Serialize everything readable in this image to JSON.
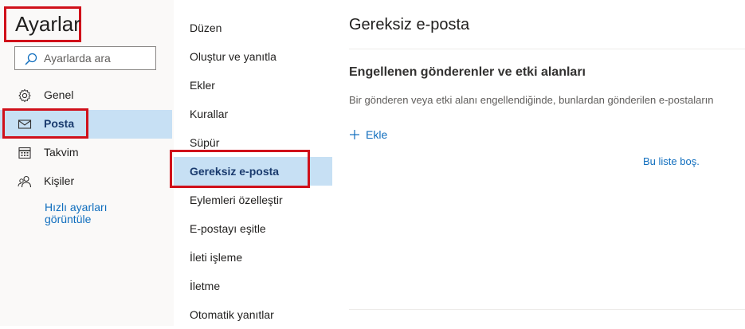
{
  "settings": {
    "title": "Ayarlar",
    "search_placeholder": "Ayarlarda ara",
    "nav": [
      {
        "label": "Genel",
        "icon": "gear-icon"
      },
      {
        "label": "Posta",
        "icon": "mail-icon",
        "selected": true
      },
      {
        "label": "Takvim",
        "icon": "calendar-icon"
      },
      {
        "label": "Kişiler",
        "icon": "people-icon"
      }
    ],
    "quick_settings_link": "Hızlı ayarları görüntüle"
  },
  "mail_sections": [
    {
      "label": "Düzen"
    },
    {
      "label": "Oluştur ve yanıtla"
    },
    {
      "label": "Ekler"
    },
    {
      "label": "Kurallar"
    },
    {
      "label": "Süpür"
    },
    {
      "label": "Gereksiz e-posta",
      "selected": true
    },
    {
      "label": "Eylemleri özelleştir"
    },
    {
      "label": "E-postayı eşitle"
    },
    {
      "label": "İleti işleme"
    },
    {
      "label": "İletme"
    },
    {
      "label": "Otomatik yanıtlar"
    }
  ],
  "content": {
    "title": "Gereksiz e-posta",
    "section_title": "Engellenen gönderenler ve etki alanları",
    "section_desc": "Bir gönderen veya etki alanı engellendiğinde, bunlardan gönderilen e-postaların",
    "add_label": "Ekle",
    "empty_text": "Bu liste boş."
  },
  "colors": {
    "accent": "#106ebe",
    "selected_bg": "#c7e0f4",
    "highlight_border": "#d0101a"
  }
}
